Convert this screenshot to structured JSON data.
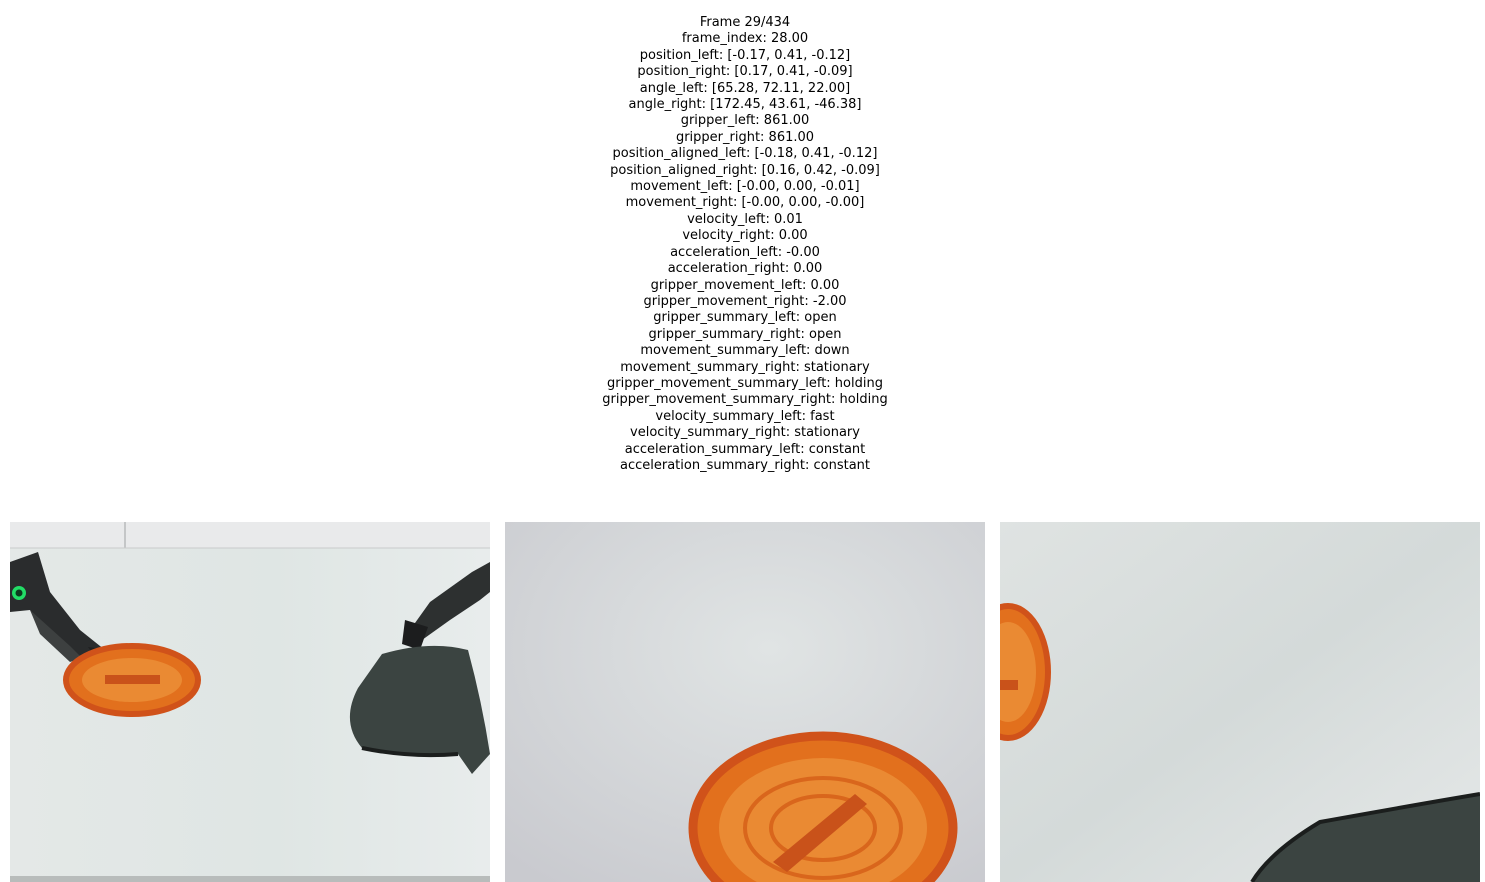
{
  "frame_header": "Frame 29/434",
  "lines": [
    "frame_index: 28.00",
    "position_left: [-0.17, 0.41, -0.12]",
    "position_right: [0.17, 0.41, -0.09]",
    "angle_left: [65.28, 72.11, 22.00]",
    "angle_right: [172.45, 43.61, -46.38]",
    "gripper_left: 861.00",
    "gripper_right: 861.00",
    "position_aligned_left: [-0.18, 0.41, -0.12]",
    "position_aligned_right: [0.16, 0.42, -0.09]",
    "movement_left: [-0.00, 0.00, -0.01]",
    "movement_right: [-0.00, 0.00, -0.00]",
    "velocity_left: 0.01",
    "velocity_right: 0.00",
    "acceleration_left: -0.00",
    "acceleration_right: 0.00",
    "gripper_movement_left: 0.00",
    "gripper_movement_right: -2.00",
    "gripper_summary_left: open",
    "gripper_summary_right: open",
    "movement_summary_left: down",
    "movement_summary_right: stationary",
    "gripper_movement_summary_left: holding",
    "gripper_movement_summary_right: holding",
    "velocity_summary_left: fast",
    "velocity_summary_right: stationary",
    "acceleration_summary_left: constant",
    "acceleration_summary_right: constant"
  ],
  "colors": {
    "table_surface": "#e6ebe9",
    "basket_orange": "#e2701d",
    "basket_rim": "#d0521a",
    "cloth_dark": "#3b4441",
    "robot_arm": "#2a2c2d",
    "status_led": "#22dd66"
  },
  "panels": [
    {
      "name": "camera-view-front",
      "content": [
        "robot-arm-left",
        "robot-arm-right",
        "orange-basket",
        "dark-cloth"
      ]
    },
    {
      "name": "camera-view-wrist-left",
      "content": [
        "orange-basket"
      ]
    },
    {
      "name": "camera-view-wrist-right",
      "content": [
        "orange-basket",
        "dark-cloth"
      ]
    }
  ]
}
